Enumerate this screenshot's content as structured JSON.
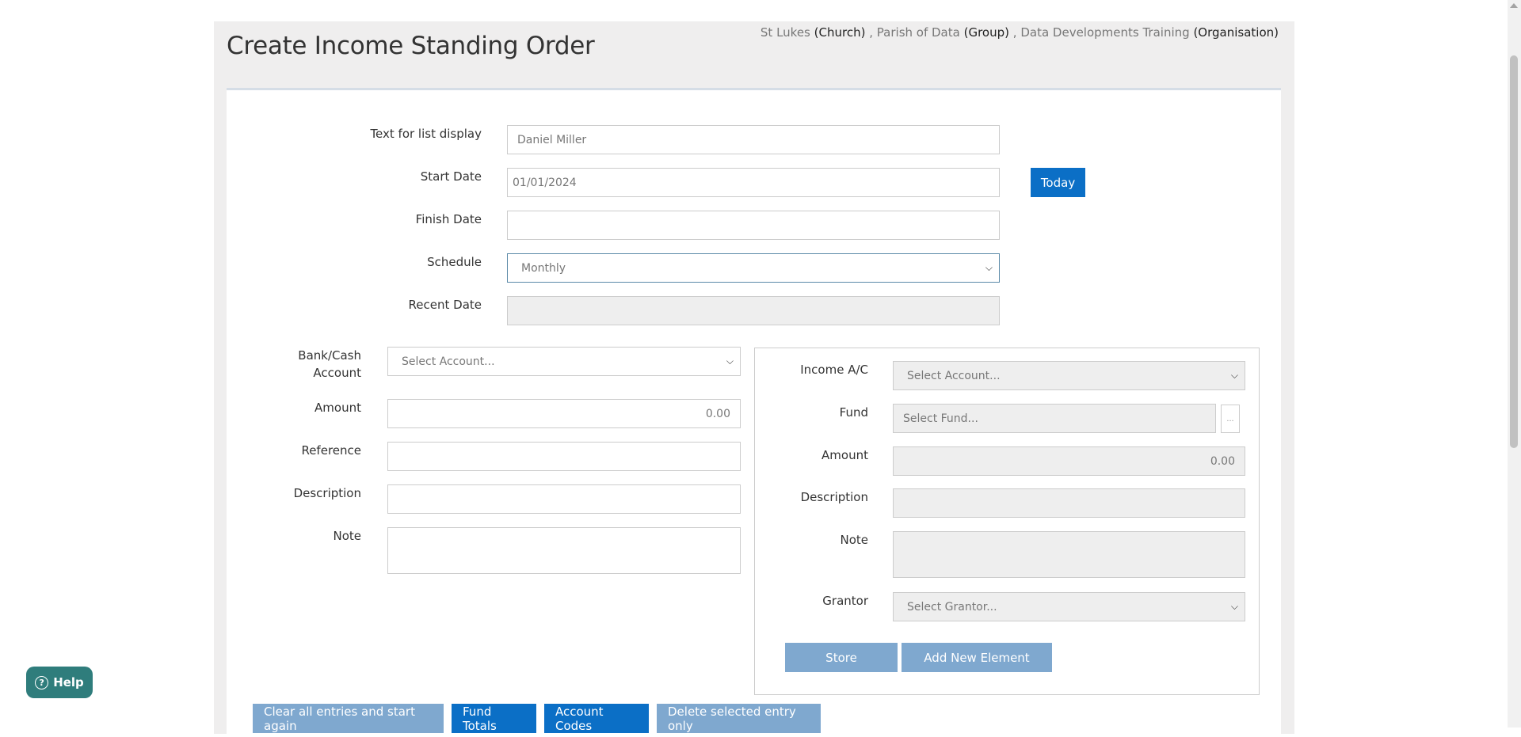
{
  "page": {
    "title": "Create Income Standing Order",
    "breadcrumb": [
      {
        "name": "St Lukes",
        "type": "(Church)"
      },
      {
        "name": "Parish of Data",
        "type": "(Group)"
      },
      {
        "name": "Data Developments Training",
        "type": "(Organisation)"
      }
    ],
    "separator": ","
  },
  "form": {
    "text_for_list_display": {
      "label": "Text for list display",
      "value": "Daniel Miller"
    },
    "start_date": {
      "label": "Start Date",
      "value": "01/01/2024"
    },
    "today_button": "Today",
    "finish_date": {
      "label": "Finish Date",
      "value": ""
    },
    "schedule": {
      "label": "Schedule",
      "value": "Monthly"
    },
    "recent_date": {
      "label": "Recent Date",
      "value": ""
    }
  },
  "left": {
    "bank_account": {
      "label_line1": "Bank/Cash",
      "label_line2": "Account",
      "value": "Select Account..."
    },
    "amount": {
      "label": "Amount",
      "value": "0.00"
    },
    "reference": {
      "label": "Reference",
      "value": ""
    },
    "description": {
      "label": "Description",
      "value": ""
    },
    "note": {
      "label": "Note",
      "value": ""
    }
  },
  "right": {
    "income_ac": {
      "label": "Income A/C",
      "value": "Select Account..."
    },
    "fund": {
      "label": "Fund",
      "value": "Select Fund...",
      "more": "..."
    },
    "amount": {
      "label": "Amount",
      "value": "0.00"
    },
    "description": {
      "label": "Description",
      "value": ""
    },
    "note": {
      "label": "Note",
      "value": ""
    },
    "grantor": {
      "label": "Grantor",
      "value": "Select Grantor..."
    },
    "store_button": "Store",
    "add_element_button": "Add New Element"
  },
  "footer_buttons": {
    "clear": "Clear all entries and start again",
    "fund_totals": "Fund Totals",
    "account_codes": "Account Codes",
    "delete_selected": "Delete selected entry only"
  },
  "help": {
    "label": "Help",
    "icon": "question-icon"
  },
  "colors": {
    "primary": "#0b6fc6",
    "muted": "#7fa8cf",
    "help": "#2f7d7c"
  }
}
